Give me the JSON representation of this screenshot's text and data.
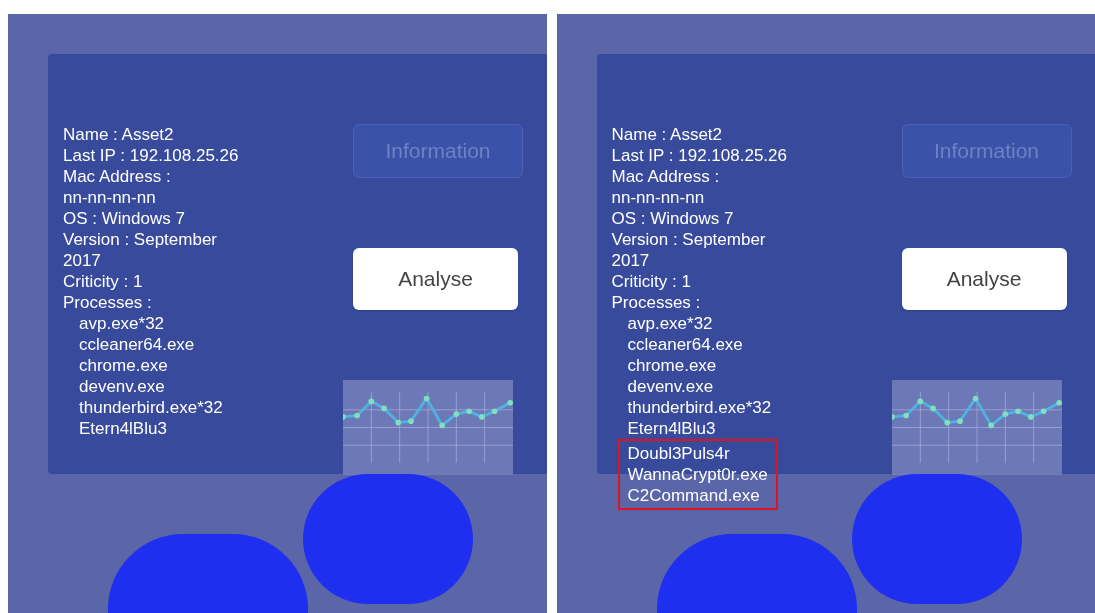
{
  "views": [
    {
      "info_lines": [
        "Name : Asset2",
        "Last IP : 192.108.25.26",
        "Mac Address :",
        "nn-nn-nn-nn",
        "OS : Windows 7",
        "Version : September",
        "2017",
        "Criticity : 1",
        "Processes :"
      ],
      "processes": [
        "avp.exe*32",
        "ccleaner64.exe",
        "chrome.exe",
        "devenv.exe",
        "thunderbird.exe*32",
        "Etern4lBlu3"
      ],
      "buttons": [
        {
          "label": "Information",
          "disabled": true
        },
        {
          "label": "Analyse",
          "disabled": false
        }
      ]
    },
    {
      "info_lines": [
        "Name : Asset2",
        "Last IP : 192.108.25.26",
        "Mac Address :",
        "nn-nn-nn-nn",
        "OS : Windows 7",
        "Version : September",
        "2017",
        "Criticity : 1",
        "Processes :"
      ],
      "processes": [
        "avp.exe*32",
        "ccleaner64.exe",
        "chrome.exe",
        "devenv.exe",
        "thunderbird.exe*32",
        "Etern4lBlu3"
      ],
      "flagged_processes": [
        "Doubl3Puls4r",
        "WannaCrypt0r.exe",
        "C2Command.exe"
      ],
      "buttons": [
        {
          "label": "Information",
          "disabled": true
        },
        {
          "label": "Analyse",
          "disabled": false
        }
      ]
    }
  ]
}
